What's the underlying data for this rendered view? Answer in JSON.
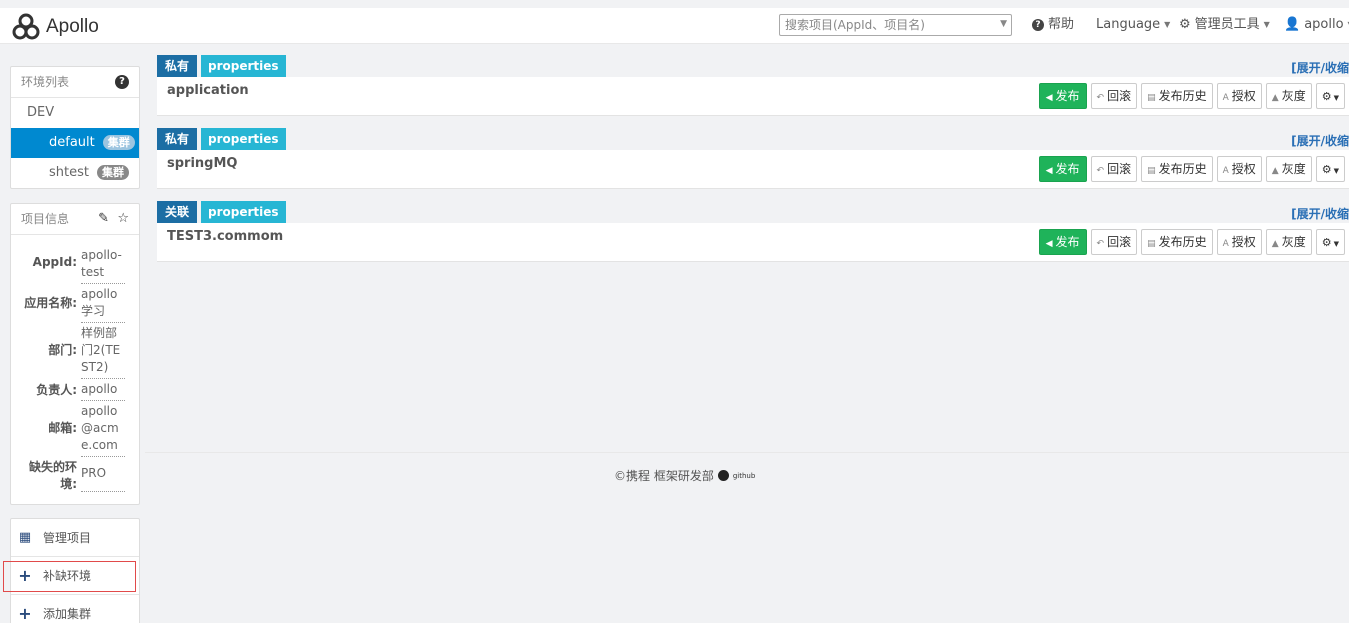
{
  "header": {
    "app_name": "Apollo",
    "search_placeholder": "搜索项目(AppId、项目名)",
    "help": "帮助",
    "language": "Language",
    "admin_tools": "管理员工具",
    "user": "apollo"
  },
  "env_panel": {
    "title": "环境列表",
    "env": "DEV",
    "clusters": [
      {
        "name": "default",
        "badge": "集群"
      },
      {
        "name": "shtest",
        "badge": "集群"
      }
    ]
  },
  "project_panel": {
    "title": "项目信息",
    "rows": [
      {
        "label": "AppId:",
        "value": "apollo-test"
      },
      {
        "label": "应用名称:",
        "value": "apollo学习"
      },
      {
        "label": "部门:",
        "value": "样例部门2(TEST2)"
      },
      {
        "label": "负责人:",
        "value": "apollo"
      },
      {
        "label": "邮箱:",
        "value": "apollo@acme.com"
      },
      {
        "label": "缺失的环境:",
        "value": "PRO"
      }
    ]
  },
  "menu": {
    "manage_project": "管理项目",
    "add_env": "补缺环境",
    "add_cluster": "添加集群"
  },
  "namespaces": [
    {
      "scope": "私有",
      "format": "properties",
      "name": "application"
    },
    {
      "scope": "私有",
      "format": "properties",
      "name": "springMQ"
    },
    {
      "scope": "关联",
      "format": "properties",
      "name": "TEST3.commom"
    }
  ],
  "ns_common": {
    "toggle": "[展开/收缩",
    "publish": "发布",
    "rollback": "回滚",
    "history": "发布历史",
    "grant": "授权",
    "gray": "灰度"
  },
  "footer": {
    "text": "©携程 框架研发部",
    "github": "github"
  },
  "colors": {
    "primary": "#0089d0",
    "publish": "#1fb35a",
    "scope_tag": "#1c6ea4",
    "format_tag": "#27b6d4"
  }
}
